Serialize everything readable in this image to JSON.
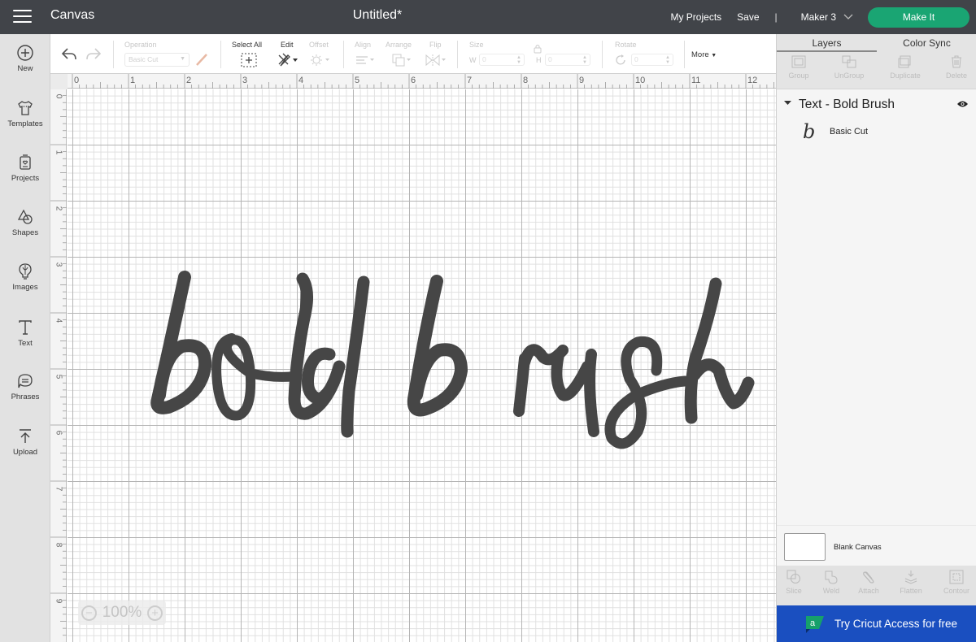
{
  "topbar": {
    "app_title": "Canvas",
    "document_title": "Untitled*",
    "my_projects": "My Projects",
    "save": "Save",
    "separator": "|",
    "machine": "Maker 3",
    "make_it": "Make It",
    "make_it_color": "#1aa573"
  },
  "sidebar": {
    "items": [
      {
        "label": "New",
        "icon": "plus-circle-icon"
      },
      {
        "label": "Templates",
        "icon": "tshirt-icon"
      },
      {
        "label": "Projects",
        "icon": "projects-icon"
      },
      {
        "label": "Shapes",
        "icon": "shapes-icon"
      },
      {
        "label": "Images",
        "icon": "lightbulb-icon"
      },
      {
        "label": "Text",
        "icon": "text-icon"
      },
      {
        "label": "Phrases",
        "icon": "speech-bubble-icon"
      },
      {
        "label": "Upload",
        "icon": "upload-icon"
      }
    ]
  },
  "toolbar": {
    "operation_label": "Operation",
    "operation_value": "Basic Cut",
    "select_all": "Select All",
    "edit": "Edit",
    "offset": "Offset",
    "align": "Align",
    "arrange": "Arrange",
    "flip": "Flip",
    "size": "Size",
    "width_label": "W",
    "width_value": "0",
    "height_label": "H",
    "height_value": "0",
    "rotate": "Rotate",
    "rotate_value": "0",
    "more": "More"
  },
  "canvas": {
    "ruler_x": [
      "0",
      "1",
      "2",
      "3",
      "4",
      "5",
      "6",
      "7",
      "8",
      "9",
      "10",
      "11",
      "12"
    ],
    "ruler_y": [
      "0",
      "1",
      "2",
      "3",
      "4",
      "5",
      "6",
      "7",
      "8",
      "9"
    ],
    "artwork_text": "bold brush",
    "artwork_color": "#464646",
    "zoom_level": "100%"
  },
  "right_panel": {
    "tabs": [
      "Layers",
      "Color Sync"
    ],
    "active_tab": "Layers",
    "layer_tools": [
      "Group",
      "UnGroup",
      "Duplicate",
      "Delete"
    ],
    "layer": {
      "name": "Text - Bold Brush",
      "sublayer_glyph": "b",
      "sublayer_name": "Basic Cut"
    },
    "blank_canvas": "Blank Canvas",
    "bottom_tools": [
      "Slice",
      "Weld",
      "Attach",
      "Flatten",
      "Contour"
    ],
    "access_banner": "Try Cricut Access for free",
    "access_color": "#1a4fc0"
  }
}
